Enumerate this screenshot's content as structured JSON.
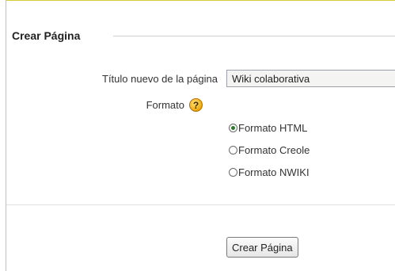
{
  "form": {
    "legend": "Crear Página",
    "title_label": "Título nuevo de la página",
    "title_value": "Wiki colaborativa",
    "format_label": "Formato",
    "help_icon": "help-icon",
    "formats": [
      {
        "label": "Formato HTML",
        "checked": true
      },
      {
        "label": "Formato Creole",
        "checked": false
      },
      {
        "label": "Formato NWIKI",
        "checked": false
      }
    ],
    "submit_label": "Crear Página"
  },
  "colors": {
    "frame_border": "#d8cc3a",
    "help_icon": "#f3b21b",
    "radio_dot": "#2b7a2b"
  }
}
